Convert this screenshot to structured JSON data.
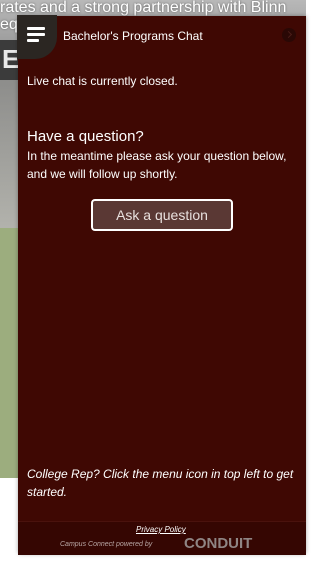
{
  "background_page": {
    "line1": "rates and a strong partnership with Blinn",
    "line2": "equ",
    "sign_text": "EX"
  },
  "chat": {
    "title": "Bachelor's Programs Chat",
    "status": "Live chat is currently closed.",
    "question_heading": "Have a question?",
    "question_description": "In the meantime please ask your question below, and we will follow up shortly.",
    "ask_button_label": "Ask a question",
    "rep_hint": "College Rep? Click the menu icon in top left to get started.",
    "menu_icon": "hamburger-menu-icon",
    "close_icon": "chevron-right-icon"
  },
  "footer": {
    "privacy_link": "Privacy Policy",
    "powered_by": "Campus Connect powered by",
    "brand_logo": "CONDUIT"
  },
  "colors": {
    "chat_background": "#3f0803",
    "footer_background": "#350602",
    "button_background": "#5a3834",
    "background_green": "#9cad7e"
  }
}
